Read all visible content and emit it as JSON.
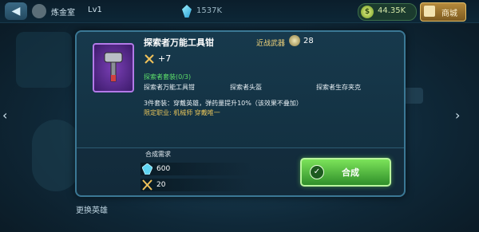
{
  "topbar": {
    "title": "炼金室",
    "level": "Lv1",
    "crystals": "1537K",
    "coins": "44.35K",
    "shop_label": "商城"
  },
  "background": {
    "swap_hero_label": "更换英雄"
  },
  "dialog": {
    "item_name": "探索者万能工具钳",
    "item_type": "近战武器",
    "power": "28",
    "attack_bonus": "+7",
    "set_name": "探索者套装(0/3)",
    "set_items": [
      "探索者万能工具钳",
      "探索者头盔",
      "探索者生存夹克"
    ],
    "set_bonus": "3件套装：穿戴英雄，弹药量提升10%（该效果不叠加）",
    "restriction": "限定职业: 机械师    穿戴唯一",
    "craft_requirement_label": "合成需求",
    "costs": [
      {
        "icon": "crystal-icon",
        "value": "600"
      },
      {
        "icon": "crossed-swords-icon",
        "value": "20"
      }
    ],
    "craft_button_label": "合成"
  },
  "colors": {
    "accent_green": "#5ee06a",
    "gold": "#e6c35a",
    "border": "#3b7895"
  }
}
